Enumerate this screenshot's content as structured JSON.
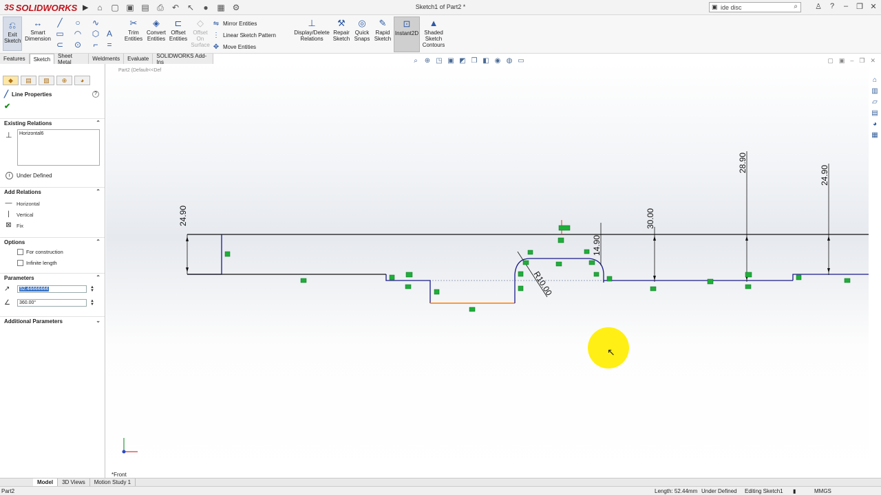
{
  "app": {
    "brand_prefix": "3S",
    "brand": "SOLIDWORKS",
    "doc_title": "Sketch1 of Part2 *",
    "search_value": "ide disc"
  },
  "ribbon": {
    "exit_sketch": "Exit Sketch",
    "smart_dimension": "Smart Dimension",
    "trim_entities": "Trim Entities",
    "convert_entities": "Convert Entities",
    "offset_entities": "Offset Entities",
    "offset_on_surface": "Offset On Surface",
    "mirror_entities": "Mirror Entities",
    "linear_sketch_pattern": "Linear Sketch Pattern",
    "move_entities": "Move Entities",
    "display_delete_relations": "Display/Delete Relations",
    "repair_sketch": "Repair Sketch",
    "quick_snaps": "Quick Snaps",
    "rapid_sketch": "Rapid Sketch",
    "instant2d": "Instant2D",
    "shaded_sketch_contours": "Shaded Sketch Contours"
  },
  "cm_tabs": [
    "Features",
    "Sketch",
    "Sheet Metal",
    "Weldments",
    "Evaluate",
    "SOLIDWORKS Add-Ins"
  ],
  "panel": {
    "title": "Line Properties",
    "existing_relations_header": "Existing Relations",
    "existing_relations": [
      "Horizontal6"
    ],
    "status": "Under Defined",
    "add_relations_header": "Add Relations",
    "add_relations": [
      "Horizontal",
      "Vertical",
      "Fix"
    ],
    "options_header": "Options",
    "options": [
      "For construction",
      "Infinite length"
    ],
    "parameters_header": "Parameters",
    "length_value": "52.44444444",
    "angle_value": "360.00°",
    "additional_header": "Additional Parameters"
  },
  "canvas": {
    "tree_stub": "Part2 (Default<<Def",
    "view_label": "*Front",
    "dimensions": {
      "d_left": "24.90",
      "d_mid": "14.90",
      "d_30": "30.00",
      "d_28": "28.90",
      "d_24r": "24.90",
      "radius": "R10.00"
    }
  },
  "bottom_tabs": [
    "Model",
    "3D Views",
    "Motion Study 1"
  ],
  "statusbar": {
    "part": "Part2",
    "length": "Length: 52.44mm",
    "defined": "Under Defined",
    "editing": "Editing Sketch1",
    "units": "MMGS"
  },
  "colors": {
    "accent": "#2d5aa6",
    "sketch_line": "#1a1a8c",
    "selected": "#ff8a1f",
    "relation": "#1fae3a",
    "cursor_highlight": "#ffee00"
  }
}
